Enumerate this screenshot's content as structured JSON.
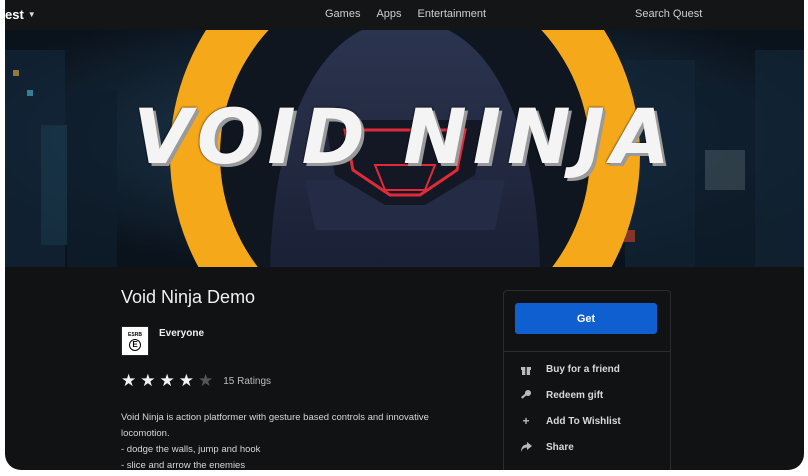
{
  "topbar": {
    "brand": "est",
    "nav": [
      "Games",
      "Apps",
      "Entertainment"
    ],
    "search_placeholder": "Search Quest"
  },
  "hero": {
    "title": "VOID NINJA",
    "colors": {
      "ring": "#f6a81b",
      "sky": "#0e1620",
      "visor": "#e02a3a"
    }
  },
  "app": {
    "title": "Void Ninja Demo",
    "age_rating": "Everyone",
    "esrb_label": "ESRB",
    "esrb_code": "E",
    "stars_filled": 4,
    "stars_total": 5,
    "ratings_count": "15 Ratings",
    "description": [
      "Void Ninja is action platformer with gesture based controls and innovative",
      "locomotion.",
      "- dodge the walls, jump and hook",
      "- slice and arrow the enemies"
    ]
  },
  "panel": {
    "get_label": "Get",
    "actions": [
      {
        "label": "Buy for a friend",
        "icon": "gift-icon"
      },
      {
        "label": "Redeem gift",
        "icon": "key-icon"
      },
      {
        "label": "Add To Wishlist",
        "icon": "plus-icon"
      },
      {
        "label": "Share",
        "icon": "share-icon"
      }
    ],
    "accent": "#0f5fd1"
  }
}
